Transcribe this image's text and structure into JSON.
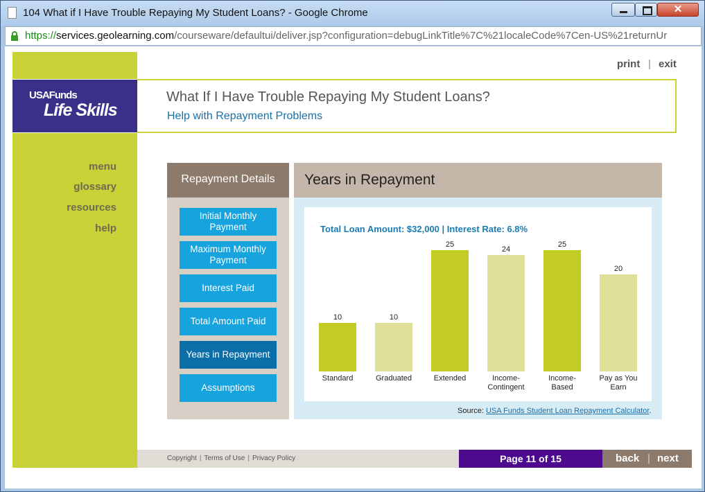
{
  "window": {
    "title": "104 What if I Have Trouble Repaying My Student Loans? - Google Chrome",
    "close_glyph": "✕"
  },
  "address": {
    "scheme": "https://",
    "host": "services.geolearning.com",
    "path": "/courseware/defaultui/deliver.jsp?configuration=debugLinkTitle%7C%21localeCode%7Cen-US%21returnUr"
  },
  "logo": {
    "top": "USAFunds",
    "main": "Life Skills"
  },
  "sidenav": [
    "menu",
    "glossary",
    "resources",
    "help"
  ],
  "toplinks": {
    "print": "print",
    "separator": "|",
    "exit": "exit"
  },
  "header": {
    "title": "What If I Have Trouble Repaying My Student Loans?",
    "subtitle": "Help with Repayment Problems"
  },
  "details_panel": {
    "title": "Repayment Details",
    "buttons": [
      {
        "label": "Initial Monthly Payment",
        "active": false
      },
      {
        "label": "Maximum Monthly Payment",
        "active": false
      },
      {
        "label": "Interest Paid",
        "active": false
      },
      {
        "label": "Total Amount Paid",
        "active": false
      },
      {
        "label": "Years in Repayment",
        "active": true
      },
      {
        "label": "Assumptions",
        "active": false
      }
    ]
  },
  "chart_panel": {
    "title": "Years in Repayment",
    "source_prefix": "Source: ",
    "source_link": "USA Funds Student Loan Repayment Calculator",
    "source_suffix": "."
  },
  "colors": {
    "bar_dark": "#c2cc22",
    "bar_light": "#dfe199",
    "accent_lime": "#c8d135",
    "logo_purple": "#39308a"
  },
  "chart_data": {
    "type": "bar",
    "title": "Total Loan Amount: $32,000 | Interest Rate: 6.8%",
    "categories": [
      "Standard",
      "Graduated",
      "Extended",
      "Income-Contingent",
      "Income-Based",
      "Pay as You Earn"
    ],
    "category_lines": [
      [
        "Standard"
      ],
      [
        "Graduated"
      ],
      [
        "Extended"
      ],
      [
        "Income-",
        "Contingent"
      ],
      [
        "Income-",
        "Based"
      ],
      [
        "Pay as You",
        "Earn"
      ]
    ],
    "values": [
      10,
      10,
      25,
      24,
      25,
      20
    ],
    "bar_colors": [
      "#c2cc22",
      "#dfe199",
      "#c2cc22",
      "#dfe199",
      "#c2cc22",
      "#dfe199"
    ],
    "data_labels": true,
    "xlabel": "",
    "ylabel": "",
    "ylim": [
      0,
      25
    ],
    "grid": false,
    "legend": "none"
  },
  "footer": {
    "links": [
      "Copyright",
      "Terms of Use",
      "Privacy Policy"
    ],
    "page": "Page 11 of 15",
    "back": "back",
    "nav_separator": "|",
    "next": "next"
  }
}
